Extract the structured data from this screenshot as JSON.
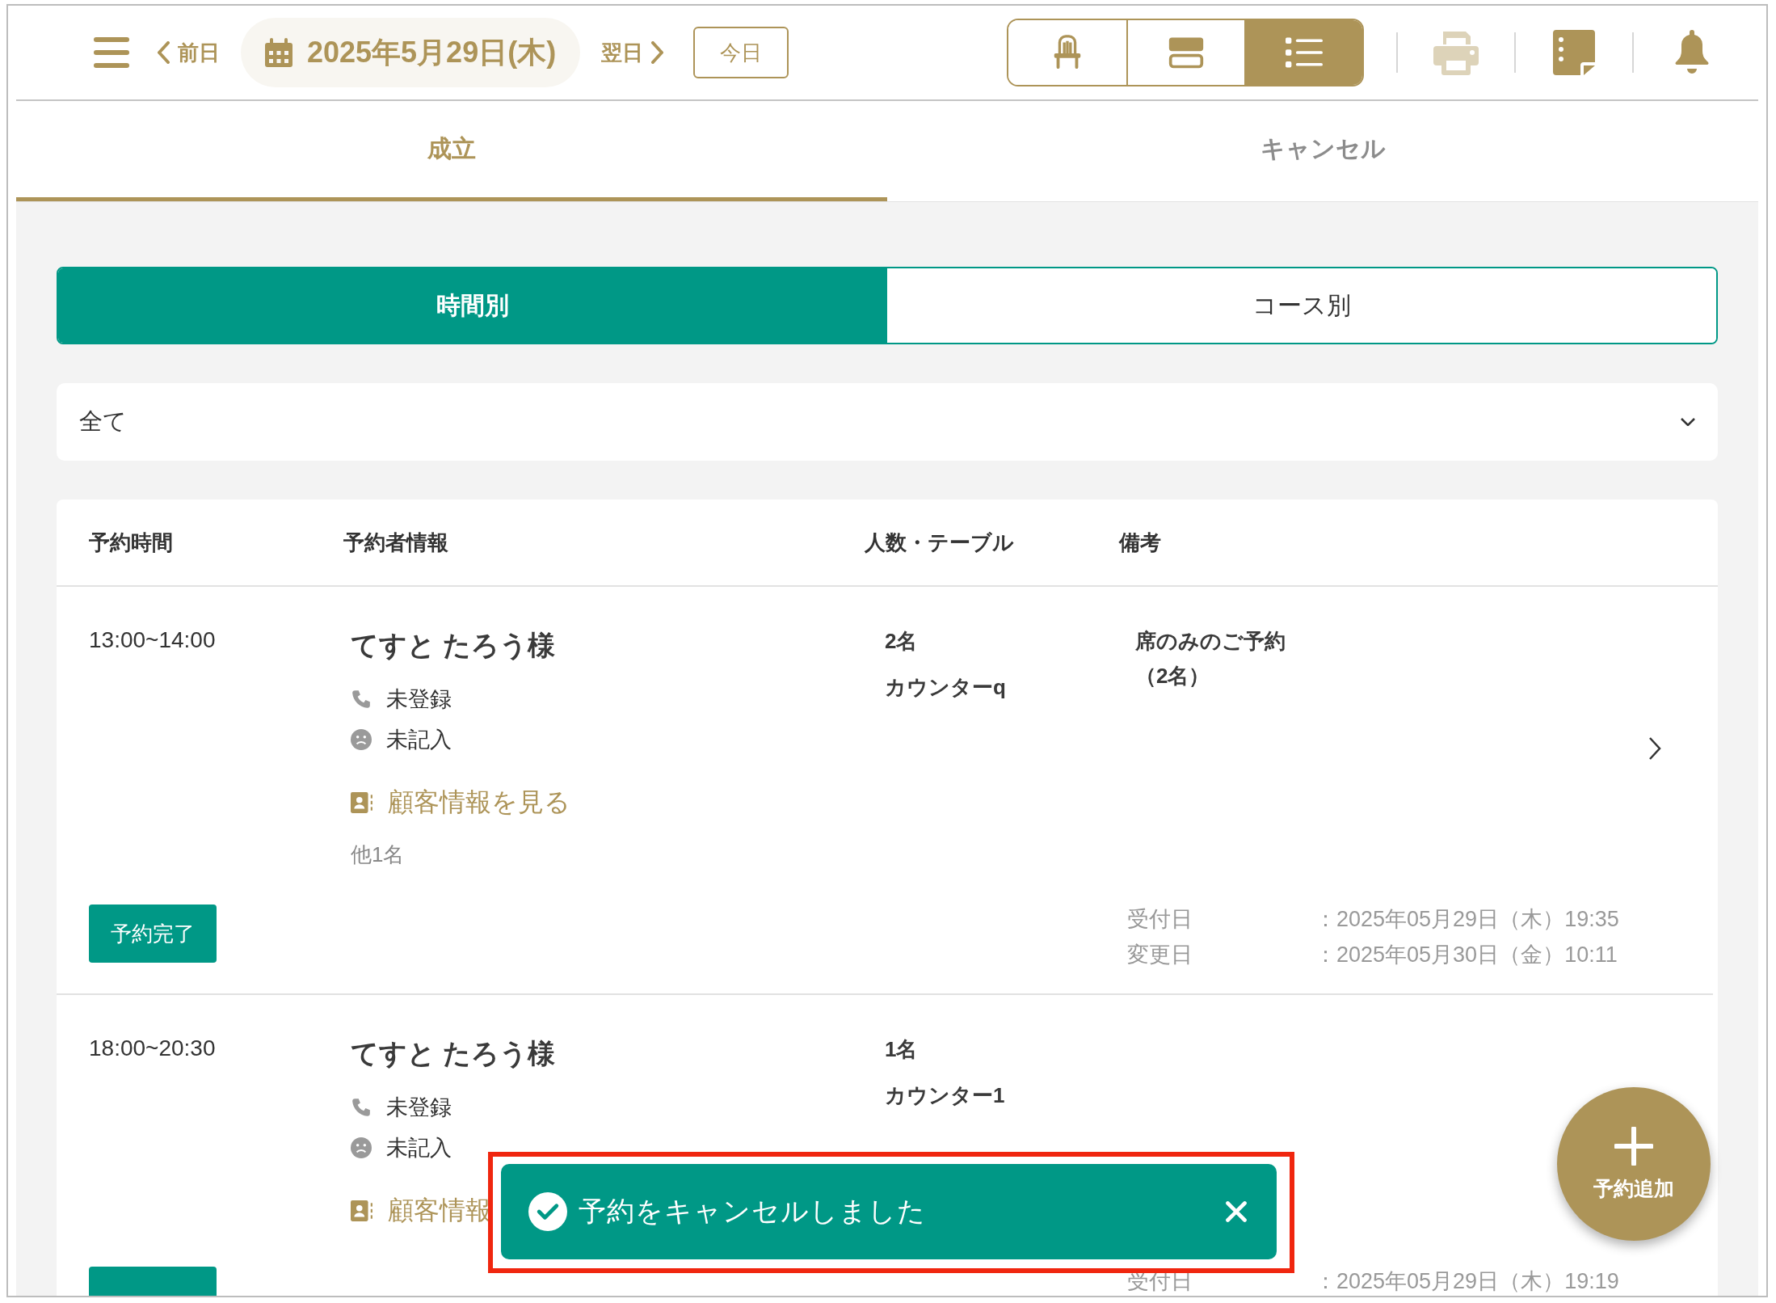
{
  "header": {
    "prev": "前日",
    "date": "2025年5月29日(木)",
    "next": "翌日",
    "today": "今日",
    "views": [
      {
        "kind": "seat",
        "selected": false
      },
      {
        "kind": "rows",
        "selected": false
      },
      {
        "kind": "list",
        "selected": true
      }
    ]
  },
  "tabs": [
    {
      "label": "成立",
      "selected": true
    },
    {
      "label": "キャンセル",
      "selected": false
    }
  ],
  "segments": [
    {
      "label": "時間別",
      "selected": true
    },
    {
      "label": "コース別",
      "selected": false
    }
  ],
  "filter": {
    "value": "全て"
  },
  "table": {
    "columns": [
      "予約時間",
      "予約者情報",
      "人数・テーブル",
      "備考"
    ],
    "rows": [
      {
        "time": "13:00~14:00",
        "name": "てすと たろう様",
        "phone": "未登録",
        "note": "未記入",
        "link": "顧客情報を見る",
        "others": "他1名",
        "party": "2名",
        "table": "カウンターq",
        "remarks": [
          "席のみのご予約",
          "（2名）"
        ],
        "status": "予約完了",
        "dates": [
          {
            "label": "受付日",
            "value": "：2025年05月29日（木）19:35"
          },
          {
            "label": "変更日",
            "value": "：2025年05月30日（金）10:11"
          }
        ]
      },
      {
        "time": "18:00~20:30",
        "name": "てすと たろう様",
        "phone": "未登録",
        "note": "未記入",
        "link": "顧客情報",
        "party": "1名",
        "table": "カウンター1",
        "remarks": [],
        "dates": [
          {
            "label": "受付日",
            "value": "：2025年05月29日（木）19:19"
          }
        ]
      }
    ]
  },
  "toast": {
    "message": "予約をキャンセルしました"
  },
  "fab": {
    "label": "予約追加"
  }
}
